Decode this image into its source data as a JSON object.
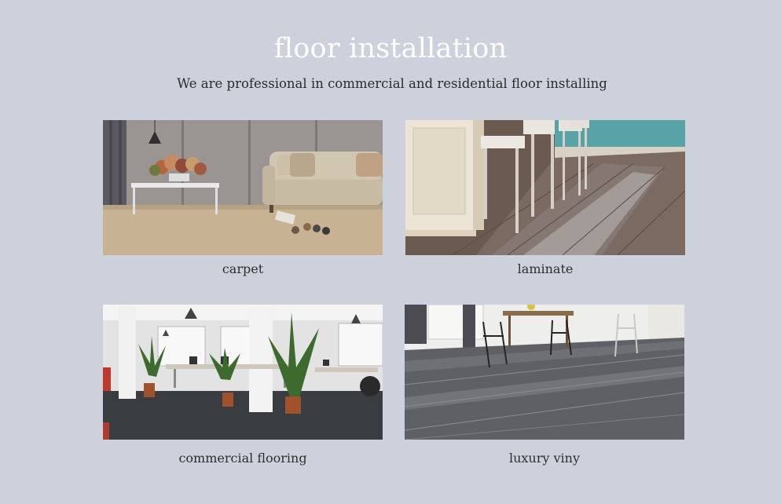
{
  "header": {
    "title": "floor installation",
    "subtitle": "We are professional in commercial and residential floor installing"
  },
  "services": [
    {
      "label": "carpet",
      "image": "living-room-with-carpet-photo"
    },
    {
      "label": "laminate",
      "image": "kitchen-bar-stools-laminate-photo"
    },
    {
      "label": "commercial flooring",
      "image": "open-office-with-plants-photo"
    },
    {
      "label": "luxury viny",
      "image": "dining-room-vinyl-plank-photo"
    }
  ]
}
